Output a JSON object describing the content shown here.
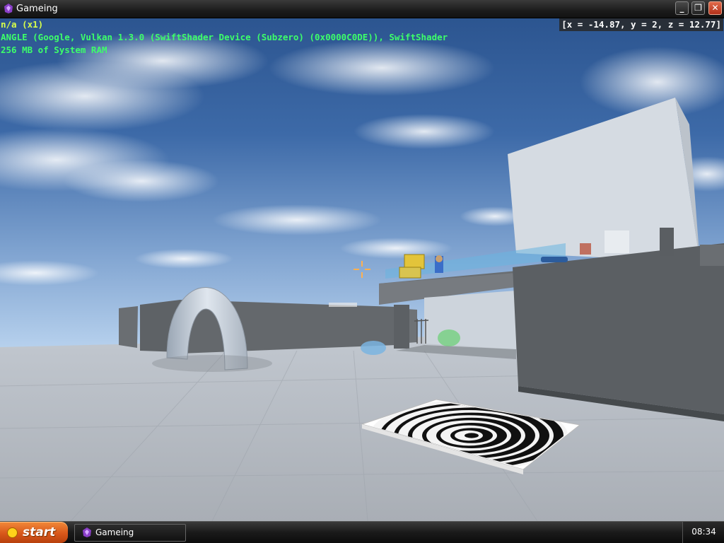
{
  "window": {
    "title": "Gameing"
  },
  "hud": {
    "line1": "n/a (x1)",
    "line2": "ANGLE (Google, Vulkan 1.3.0 (SwiftShader Device (Subzero) (0x0000C0DE)), SwiftShader",
    "line3": "256 MB of System RAM",
    "coords": "[x = -14.87, y = 2, z = 12.77]"
  },
  "taskbar": {
    "start_label": "start",
    "task_label": "Gameing",
    "clock": "08:34"
  },
  "colors": {
    "hud_yellow": "#d8ff4a",
    "hud_green": "#3dff6a",
    "start_orange": "#e06a24",
    "close_red": "#c8401e"
  },
  "icons": [
    "app-icon",
    "minimize-icon",
    "maximize-icon",
    "close-icon",
    "start-smile-icon",
    "crosshair-icon"
  ]
}
